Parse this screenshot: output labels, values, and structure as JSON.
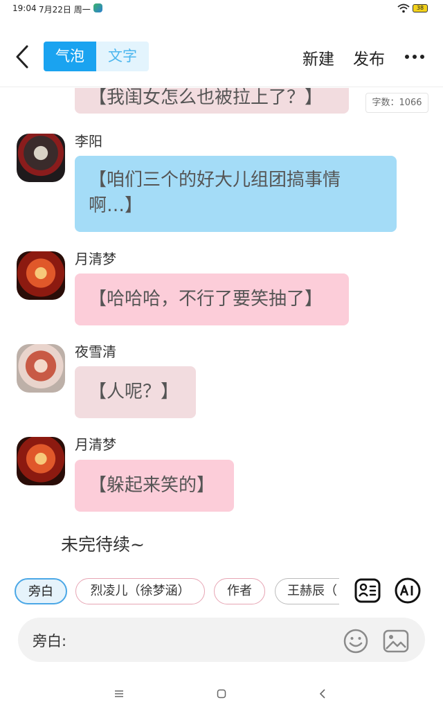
{
  "status_bar": {
    "time": "19:04",
    "date": "7月22日 周一",
    "battery": "38"
  },
  "header": {
    "mode_bubble": "气泡",
    "mode_text": "文字",
    "new_label": "新建",
    "publish_label": "发布"
  },
  "word_count": "字数：1066",
  "messages": [
    {
      "text": "【我闺女怎么也被拉上了？】"
    },
    {
      "speaker": "李阳",
      "text": "【咱们三个的好大儿组团搞事情啊…】"
    },
    {
      "speaker": "月清梦",
      "text": "【哈哈哈，不行了要笑抽了】"
    },
    {
      "speaker": "夜雪清",
      "text": "【人呢？】"
    },
    {
      "speaker": "月清梦",
      "text": "【躲起来笑的】"
    }
  ],
  "to_be_continued": "未完待续~",
  "roles": [
    "旁白",
    "烈凌儿（徐梦涵）",
    "作者",
    "王赫辰（"
  ],
  "input": {
    "prefix": "旁白:"
  },
  "colors": {
    "accent": "#1aa3f0",
    "bubble_blue": "#a4dcf7",
    "bubble_pink": "#fccdd9",
    "bubble_rose": "#f2dcdf"
  },
  "icons": [
    "back-icon",
    "more-icon",
    "contact-card-icon",
    "ai-icon",
    "emoji-icon",
    "image-icon",
    "wifi-icon",
    "battery-icon"
  ]
}
